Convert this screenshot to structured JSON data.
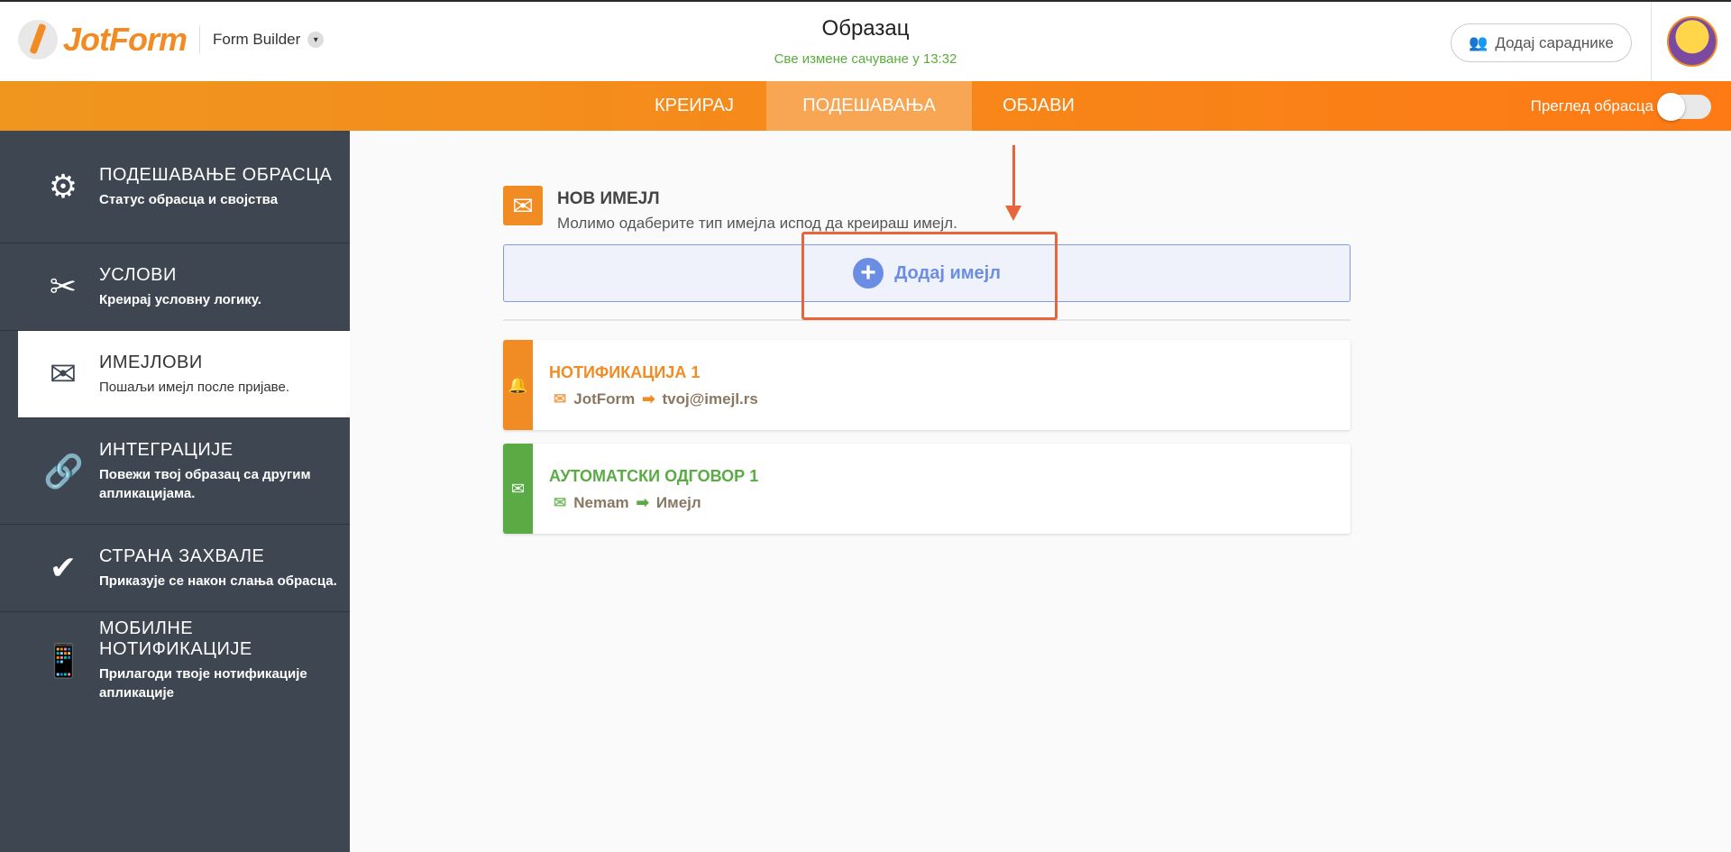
{
  "header": {
    "logo": "JotForm",
    "app_label": "Form Builder",
    "title": "Образац",
    "saved_status": "Све измене сачуване у 13:32",
    "collab_button": "Додај сараднике"
  },
  "nav": {
    "tabs": [
      "КРЕИРАЈ",
      "ПОДЕШАВАЊА",
      "ОБЈАВИ"
    ],
    "active_tab": "ПОДЕШАВАЊА",
    "preview_label": "Преглед обрасца",
    "preview_on": false
  },
  "sidebar": {
    "items": [
      {
        "title": "ПОДЕШАВАЊЕ ОБРАСЦА",
        "subtitle": "Статус обрасца и својства",
        "icon": "gear-icon"
      },
      {
        "title": "УСЛОВИ",
        "subtitle": "Креирај условну логику.",
        "icon": "conditions-icon"
      },
      {
        "title": "ИМЕЈЛОВИ",
        "subtitle": "Пошаљи имејл после пријаве.",
        "icon": "envelope-icon"
      },
      {
        "title": "ИНТЕГРАЦИЈЕ",
        "subtitle": "Повежи твој образац са другим апликацијама.",
        "icon": "link-icon"
      },
      {
        "title": "СТРАНА ЗАХВАЛЕ",
        "subtitle": "Приказује се након слања обрасца.",
        "icon": "check-icon"
      },
      {
        "title": "МОБИЛНЕ НОТИФИКАЦИЈЕ",
        "subtitle": "Прилагоди твоје нотификације апликације",
        "icon": "mobile-icon"
      }
    ]
  },
  "main": {
    "new_email_title": "НОВ ИМЕЈЛ",
    "new_email_subtitle": "Молимо одаберите тип имејла испод да креираш имејл.",
    "add_email_button": "Додај имејл",
    "emails": [
      {
        "title": "НОТИФИКАЦИЈА 1",
        "from": "JotForm",
        "to": "tvoj@imejl.rs",
        "color": "#f08c23"
      },
      {
        "title": "АУТОМАТСКИ ОДГОВОР 1",
        "from": "Nemam",
        "to": "Имејл",
        "color": "#5aab45"
      }
    ]
  }
}
